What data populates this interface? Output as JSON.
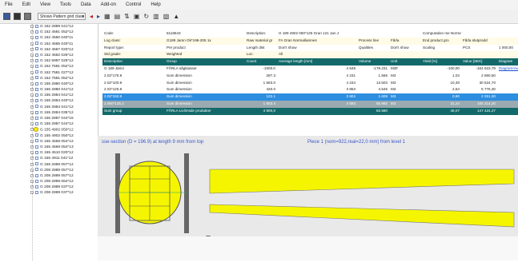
{
  "menu": [
    "File",
    "Edit",
    "View",
    "Tools",
    "Data",
    "Add-on",
    "Control",
    "Help"
  ],
  "toolbar": {
    "combo_value": "Shows Pattern grid class",
    "combo_arrow": "▾",
    "symbols": [
      {
        "name": "undo-icon",
        "glyph": "◂",
        "cls": "red"
      },
      {
        "name": "redo-icon",
        "glyph": "▸",
        "cls": "blue"
      },
      {
        "name": "table-icon",
        "glyph": "▦",
        "cls": ""
      },
      {
        "name": "chart-icon",
        "glyph": "▤",
        "cls": ""
      },
      {
        "name": "sort-icon",
        "glyph": "⇅",
        "cls": ""
      },
      {
        "name": "filter-icon",
        "glyph": "▣",
        "cls": ""
      },
      {
        "name": "refresh-icon",
        "glyph": "↻",
        "cls": ""
      },
      {
        "name": "grid-icon",
        "glyph": "▥",
        "cls": ""
      },
      {
        "name": "layers-icon",
        "glyph": "▧",
        "cls": ""
      },
      {
        "name": "pointer-icon",
        "glyph": "▲",
        "cls": ""
      }
    ]
  },
  "tree": [
    "G 152 2889 041*12",
    "G 152 4581 052*12",
    "G 152 4560 040*11",
    "G 152 4565 040*11",
    "G 152 4567 020*12",
    "G 152 4562 025*12",
    "G 152 5997 025*12",
    "G 152 7581 052*12",
    "G 152 7581 027*12",
    "G 152 7581 052*12",
    "G 155 2880 040*12",
    "G 155 2880 041*12",
    "G 155 2884 041*12",
    "G 155 2884 040*12",
    "G 155 2884 041*12",
    "G 155 2884 035*12",
    "G 155 2887 044*15",
    "G 155 2887 044*12",
    "G 155 4902 050*12",
    "G 155 4902 050*12",
    "G 155 4568 054*12",
    "G 155 4569 054*13",
    "G 155 4510 020*12",
    "G 155 4911 041*12",
    "G 155 2889 057*12",
    "G 208 2889 057*12",
    "G 208 2889 057*12",
    "G 208 2889 064*12",
    "G 208 2889 037*12",
    "G 208 2889 037*12"
  ],
  "tree_selected_index": 18,
  "props": [
    {
      "a": "Code:",
      "b": "6118643",
      "c": "Description:",
      "d": "G 189 4902 050*125 Gran 121 Jan J",
      "e": "",
      "f": "",
      "g": "Computation me Normal",
      "h": "",
      "i": ""
    },
    {
      "a": "Log class:",
      "b": "G189 Jamn Ok*196-205 1x",
      "c": "Raw material gr",
      "d": "FA Gran Normallamnes",
      "e": "Process line",
      "f": "Fårla",
      "g": "End product gro",
      "h": "Fårla slutprodd",
      "i": ""
    },
    {
      "a": "Report type:",
      "b": "Per product",
      "c": "Length dist",
      "d": "Don't show",
      "e": "Qualities",
      "f": "Don't show",
      "g": "Scaling",
      "h": "PCS",
      "i": "1 000,00"
    },
    {
      "a": "Std grade:",
      "b": "Weighted",
      "c": "Loc:",
      "d": "All",
      "e": "",
      "f": "",
      "g": "",
      "h": "",
      "i": ""
    }
  ],
  "headers": [
    "Description",
    "Group",
    "Count",
    "Average length [mm]",
    "Volume",
    "Unit",
    "Yield [%]",
    "Value [SEK]",
    "Diagram"
  ],
  "rows": [
    {
      "desc": "G 189 Jämn",
      "group": "FÅRLA sågklasser",
      "count": "-1000.0",
      "avg": "4 648",
      "vol": "-179.231",
      "unit": "M3F",
      "yield": "-100,00",
      "value": "-164 623,79",
      "link": "Diagramrow",
      "style": "data"
    },
    {
      "desc": "2.02*175.9",
      "group": "Sum dimension",
      "count": "287.3",
      "avg": "4 231",
      "vol": "1.566",
      "unit": "M3",
      "yield": "1.04",
      "value": "2 850,50",
      "link": "",
      "style": "data"
    },
    {
      "desc": "2.02*100.9",
      "group": "Sum dimension",
      "count": "1 593.0",
      "avg": "4 234",
      "vol": "13.503",
      "unit": "M3",
      "yield": "10,30",
      "value": "30 524,70",
      "link": "",
      "style": "data"
    },
    {
      "desc": "2.02*125.9",
      "group": "Sum dimension",
      "count": "420.0",
      "avg": "3 853",
      "vol": "4.545",
      "unit": "M3",
      "yield": "2,54",
      "value": "5 776,30",
      "link": "",
      "style": "data"
    },
    {
      "desc": "2.02*150.9",
      "group": "Sum dimension",
      "count": "122.1",
      "avg": "3 904",
      "vol": "1.609",
      "unit": "M3",
      "yield": "0,90",
      "value": "2 251,00",
      "link": "",
      "style": "data sel"
    },
    {
      "desc": "2.050*125.2",
      "group": "Sum dimension",
      "count": "1 903.4",
      "avg": "4 593",
      "vol": "55.993",
      "unit": "M3",
      "yield": "31,24",
      "value": "105 214,20",
      "link": "",
      "style": "data sel2"
    }
  ],
  "sum": {
    "desc": "Sum group",
    "group": "FÅRLA Livlimsde produkter",
    "count": "4 900,0",
    "avg": "",
    "vol": "82.580",
    "unit": "",
    "yield": "46,07",
    "value": "147 424,27"
  },
  "section_caption": "sse-section (D = 196.9) at length 9 mm from top",
  "piece_caption": "Piece 1 (nom=922,real=22,0 mm) from level 1",
  "colors": {
    "log": "#f5f500",
    "header": "#13696a",
    "selected": "#2d8ee0"
  }
}
